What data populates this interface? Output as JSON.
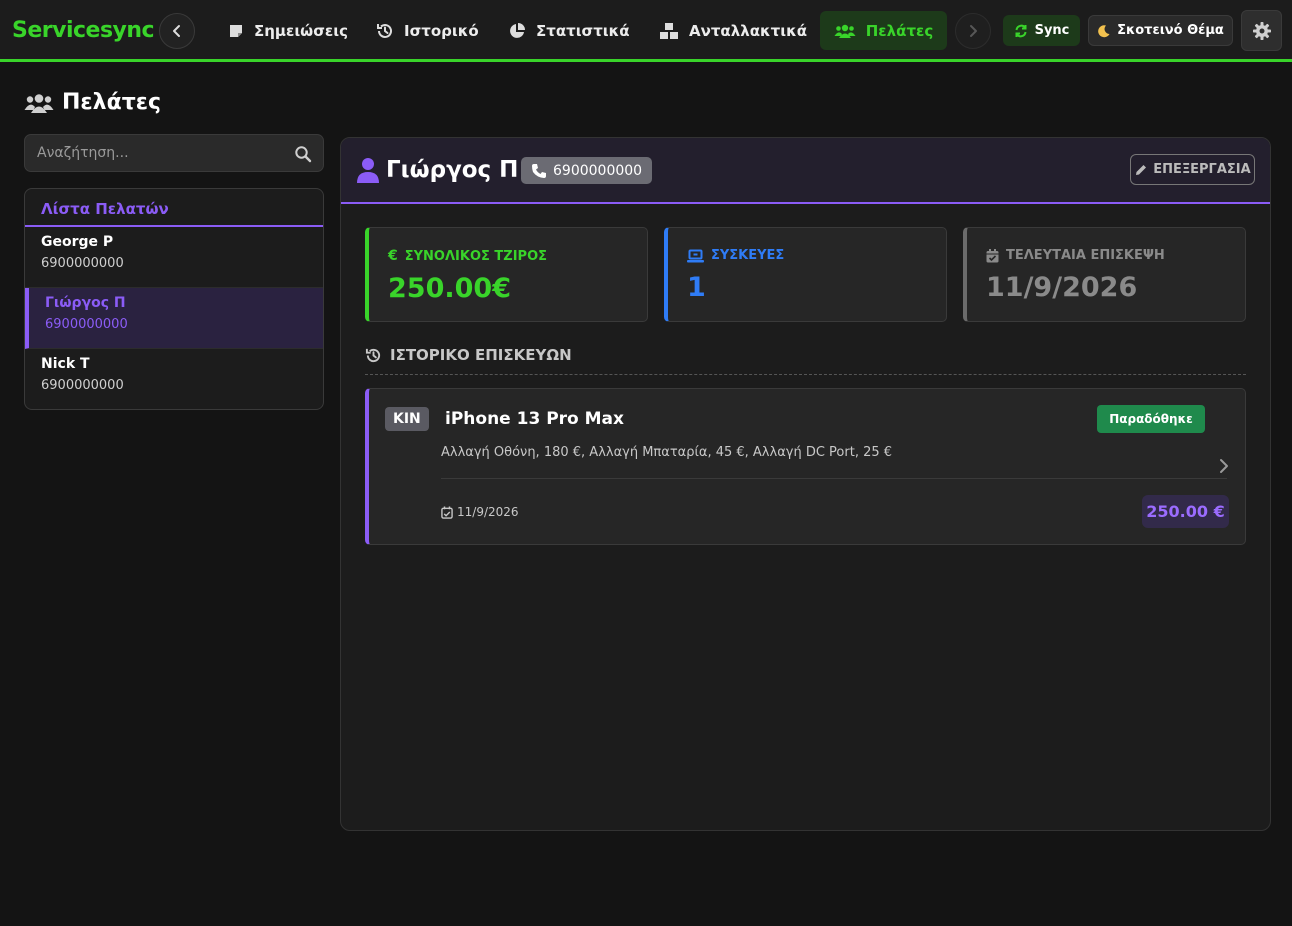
{
  "app": {
    "brand": "Servicesync"
  },
  "nav": {
    "items": [
      {
        "label": "Σημειώσεις",
        "icon": "note-icon"
      },
      {
        "label": "Ιστορικό",
        "icon": "history-icon"
      },
      {
        "label": "Στατιστικά",
        "icon": "pie-chart-icon"
      },
      {
        "label": "Ανταλλακτικά",
        "icon": "boxes-icon"
      },
      {
        "label": "Πελάτες",
        "icon": "users-icon",
        "active": true
      }
    ],
    "sync_label": "Sync",
    "theme_label": "Σκοτεινό Θέμα"
  },
  "page": {
    "title": "Πελάτες"
  },
  "search": {
    "placeholder": "Αναζήτηση..."
  },
  "client_list": {
    "header": "Λίστα Πελατών",
    "clients": [
      {
        "name": "George P",
        "phone": "6900000000"
      },
      {
        "name": "Γιώργος Π",
        "phone": "6900000000",
        "active": true
      },
      {
        "name": "Nick T",
        "phone": "6900000000"
      }
    ]
  },
  "customer": {
    "name": "Γιώργος Π",
    "phone": "6900000000",
    "edit_label": "ΕΠΕΞΕΡΓΑΣΙΑ"
  },
  "stats": {
    "revenue": {
      "label": "ΣΥΝΟΛΙΚΟΣ ΤΖΙΡΟΣ",
      "value": "250.00€"
    },
    "devices": {
      "label": "ΣΥΣΚΕΥΕΣ",
      "value": "1"
    },
    "last_visit": {
      "label": "ΤΕΛΕΥΤΑΙΑ ΕΠΙΣΚΕΨΗ",
      "value": "11/9/2026"
    }
  },
  "history": {
    "title": "ΙΣΤΟΡΙΚΟ ΕΠΙΣΚΕΥΩΝ",
    "repairs": [
      {
        "code": "ΚΙΝ",
        "model": "iPhone 13 Pro Max",
        "status": "Παραδόθηκε",
        "services": "Αλλαγή Οθόνη, 180 €, Αλλαγή Μπαταρία, 45 €, Αλλαγή DC Port, 25 €",
        "date": "11/9/2026",
        "price": "250.00 €"
      }
    ]
  },
  "colors": {
    "accent_green": "#39d42a",
    "accent_purple": "#8b5cf6",
    "accent_blue": "#2f7cf6",
    "status_delivered": "#1f8a4c"
  }
}
